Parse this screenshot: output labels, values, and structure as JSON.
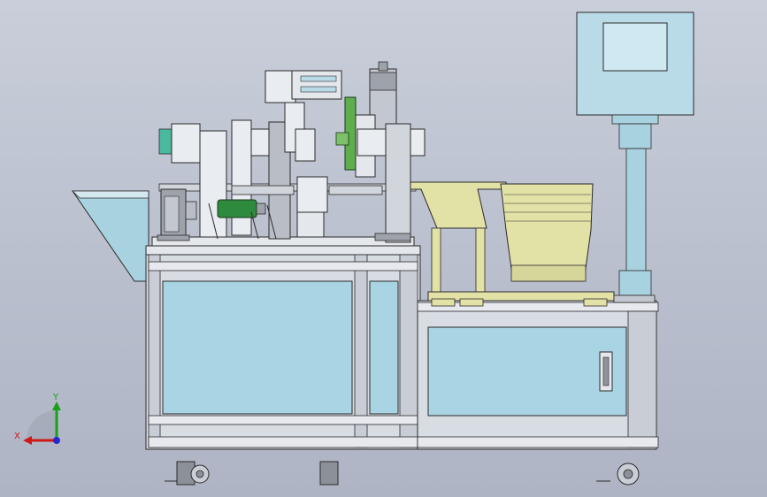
{
  "view": {
    "triad": {
      "x_label": "X",
      "y_label": "Y",
      "x_color": "#d01818",
      "y_color": "#18a018",
      "z_color": "#2828d0"
    }
  },
  "colors": {
    "background": "#c2c7d3",
    "frame": "#d8dce3",
    "frame_edge": "#2a2a2a",
    "panel_glass": "#a9d4e3",
    "feeder_yellow": "#e3e2a6",
    "cylinder_green": "#2e8a3c",
    "control_box": "#b9dbe8",
    "screen": "#cfe9f3",
    "metal_grey": "#9ea3ab"
  },
  "icons": {
    "axis_triad": "axis-triad-icon",
    "caster_wheels": "caster-wheel-icon"
  }
}
